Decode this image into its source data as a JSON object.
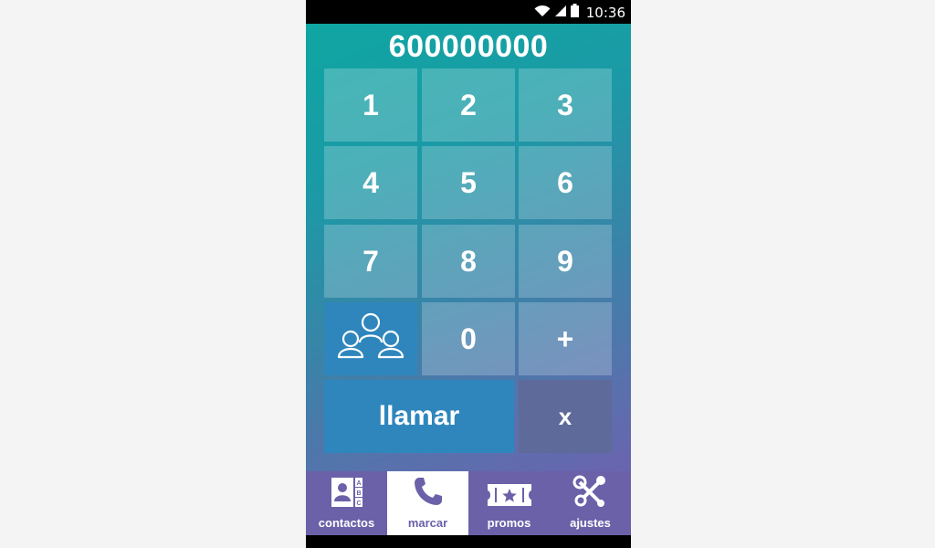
{
  "status_bar": {
    "time": "10:36"
  },
  "dialer": {
    "number": "600000000",
    "keys": [
      "1",
      "2",
      "3",
      "4",
      "5",
      "6",
      "7",
      "8",
      "9",
      "0",
      "+"
    ],
    "call_label": "llamar",
    "delete_label": "x"
  },
  "tabs": [
    {
      "label": "contactos",
      "icon": "address-book-icon",
      "active": false
    },
    {
      "label": "marcar",
      "icon": "phone-icon",
      "active": true
    },
    {
      "label": "promos",
      "icon": "ticket-star-icon",
      "active": false
    },
    {
      "label": "ajustes",
      "icon": "tools-icon",
      "active": false
    }
  ],
  "colors": {
    "gradient_top": "#0fa6a2",
    "gradient_bottom": "#6a64af",
    "accent_blue": "#2f86bd",
    "tab_bar": "#6a61a9",
    "delete_key": "#5e6a9a"
  }
}
